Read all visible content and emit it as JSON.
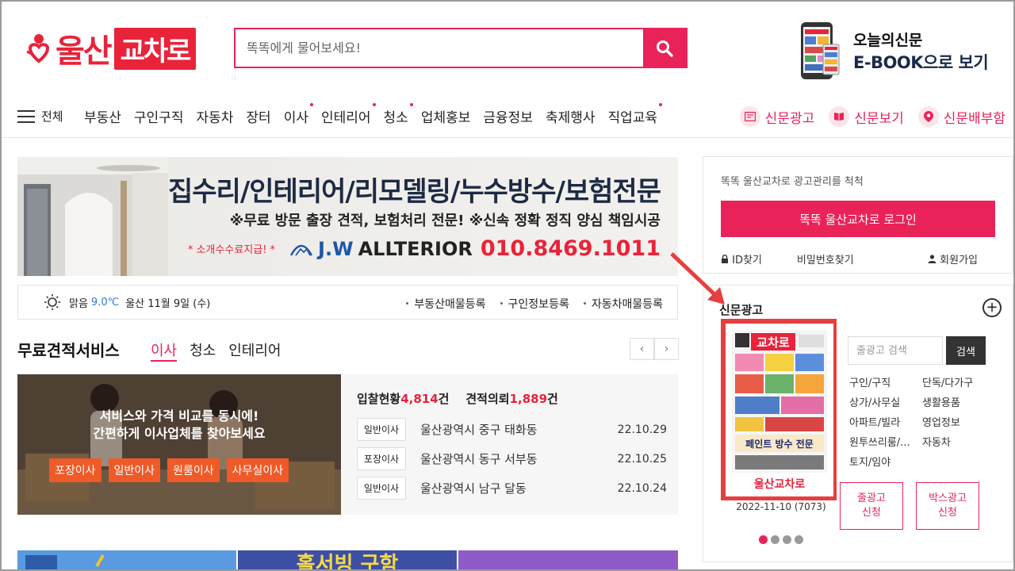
{
  "header": {
    "logo_text": "울산",
    "logo_box": "교차로",
    "search_placeholder": "똑똑에게 물어보세요!",
    "ebook_line1": "오늘의신문",
    "ebook_line2": "E-BOOK으로 보기"
  },
  "nav": {
    "all_label": "전체",
    "items": [
      {
        "label": "부동산",
        "dot": false
      },
      {
        "label": "구인구직",
        "dot": false
      },
      {
        "label": "자동차",
        "dot": false
      },
      {
        "label": "장터",
        "dot": false
      },
      {
        "label": "이사",
        "dot": true
      },
      {
        "label": "인테리어",
        "dot": true
      },
      {
        "label": "청소",
        "dot": true
      },
      {
        "label": "업체홍보",
        "dot": false
      },
      {
        "label": "금융정보",
        "dot": false
      },
      {
        "label": "축제행사",
        "dot": false
      },
      {
        "label": "직업교육",
        "dot": true
      }
    ],
    "right": [
      {
        "label": "신문광고",
        "icon": "newspaper-icon"
      },
      {
        "label": "신문보기",
        "icon": "book-icon"
      },
      {
        "label": "신문배부함",
        "icon": "location-pin-icon"
      }
    ]
  },
  "banner": {
    "line1": "집수리/인테리어/리모델링/누수방수/보험전문",
    "line2": "※무료 방문 출장 견적, 보험처리 전문!  ※신속 정확 정직 양심 책임시공",
    "tag": "* 소개수수료지급! *",
    "brand_a": "J.W",
    "brand_b": "ALLTERIOR",
    "phone": "010.8469.1011"
  },
  "weather": {
    "condition": "맑음",
    "temp": "9.0℃",
    "location_date": "울산 11월 9일 (수)",
    "links": [
      "부동산매물등록",
      "구인정보등록",
      "자동차매물등록"
    ]
  },
  "free_quote": {
    "title": "무료견적서비스",
    "tabs": [
      "이사",
      "청소",
      "인테리어"
    ],
    "photo_text1": "서비스와 가격 비교를 동시에!",
    "photo_text2": "간편하게 이사업체를 찾아보세요",
    "buttons": [
      "포장이사",
      "일반이사",
      "원룸이사",
      "사무실이사"
    ],
    "stat_bid_label": "입찰현황",
    "stat_bid_value": "4,814",
    "stat_unit": "건",
    "stat_req_label": "견적의뢰",
    "stat_req_value": "1,889",
    "rows": [
      {
        "type": "일반이사",
        "addr": "울산광역시 중구 태화동",
        "date": "22.10.29"
      },
      {
        "type": "포장이사",
        "addr": "울산광역시 동구 서부동",
        "date": "22.10.25"
      },
      {
        "type": "일반이사",
        "addr": "울산광역시 남구 달동",
        "date": "22.10.24"
      }
    ]
  },
  "login": {
    "desc": "똑똑 울산교차로 광고관리를 척척",
    "button": "똑똑 울산교차로 로그인",
    "find_id": "ID찾기",
    "find_pw": "비밀번호찾기",
    "join": "회원가입"
  },
  "newspaper_ad": {
    "title": "신문광고",
    "cover_name": "울산교차로",
    "cover_masthead": "교차로",
    "cover_headline": "페인트 방수 전문",
    "date": "2022-11-10 (7073)",
    "search_placeholder": "줄광고 검색",
    "search_button": "검색",
    "categories": [
      "구인/구직",
      "단독/다가구",
      "상가/사무실",
      "생활용품",
      "아파트/빌라",
      "영업정보",
      "원투쓰리룸/...",
      "자동차",
      "토지/임야"
    ],
    "apply_line": "줄광고\n신청",
    "apply_box": "박스광고\n신청",
    "slide_count": 4,
    "slide_active": 0
  },
  "bottom_tiles": {
    "tile2_text": "홀서빙 구함"
  },
  "colors": {
    "brand": "#e9233a",
    "accent": "#e9235a",
    "temp": "#2e7ad6",
    "button_orange": "#f05a28"
  }
}
